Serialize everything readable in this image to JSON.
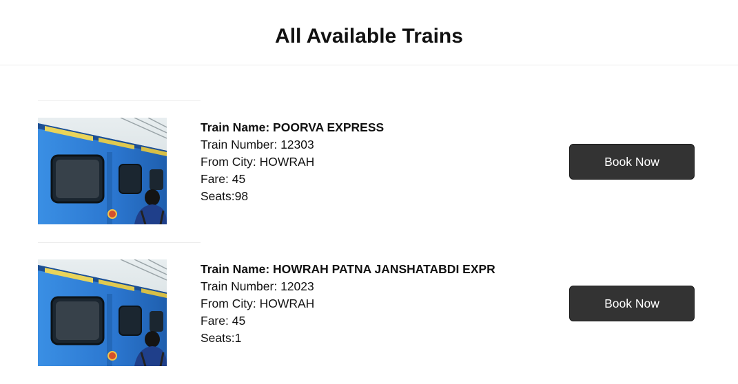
{
  "page": {
    "title": "All Available Trains"
  },
  "trains": [
    {
      "name_label": "Train Name: ",
      "name": "POORVA EXPRESS",
      "number_label": "Train Number: ",
      "number": "12303",
      "from_label": "From City: ",
      "from_city": "HOWRAH",
      "fare_label": "Fare: ",
      "fare": "45",
      "seats_label": "Seats:",
      "seats": "98",
      "book_label": "Book Now"
    },
    {
      "name_label": "Train Name: ",
      "name": "HOWRAH PATNA JANSHATABDI EXPR",
      "number_label": "Train Number: ",
      "number": "12023",
      "from_label": "From City: ",
      "from_city": "HOWRAH",
      "fare_label": "Fare: ",
      "fare": "45",
      "seats_label": "Seats:",
      "seats": "1",
      "book_label": "Book Now"
    }
  ],
  "colors": {
    "button_bg": "#333333",
    "button_text": "#ffffff",
    "train_blue": "#2f7fd6"
  }
}
